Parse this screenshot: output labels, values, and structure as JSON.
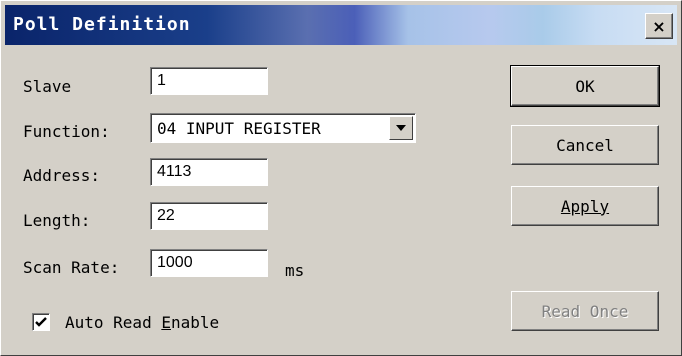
{
  "window": {
    "title": "Poll Definition",
    "close_label": "×"
  },
  "form": {
    "slave_label": "Slave",
    "slave_value": "1",
    "function_label": "Function:",
    "function_value": "04 INPUT REGISTER",
    "address_label": "Address:",
    "address_value": "4113",
    "length_label": "Length:",
    "length_value": "22",
    "scan_rate_label": "Scan Rate:",
    "scan_rate_value": "1000",
    "scan_rate_unit": "ms",
    "auto_read_checked": true,
    "auto_read_label_before": "Auto Read ",
    "auto_read_label_accel": "E",
    "auto_read_label_after": "nable"
  },
  "buttons": {
    "ok": "OK",
    "cancel": "Cancel",
    "apply": "Apply",
    "read_once": "Read Once"
  },
  "icons": {
    "dropdown": "chevron-down-icon",
    "check": "checkmark-icon",
    "close": "close-icon"
  }
}
